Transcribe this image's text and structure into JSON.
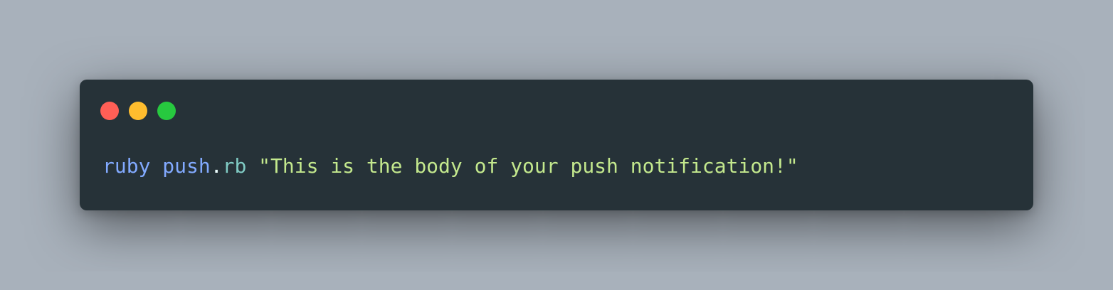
{
  "window": {
    "controls": [
      {
        "name": "close",
        "color": "#ff5f56"
      },
      {
        "name": "minimize",
        "color": "#ffbd2e"
      },
      {
        "name": "maximize",
        "color": "#27c93f"
      }
    ]
  },
  "code": {
    "command": "ruby",
    "file_base": "push",
    "file_dot": ".",
    "file_ext": "rb",
    "argument": "\"This is the body of your push notification!\""
  },
  "colors": {
    "background": "#a8b1bb",
    "terminal_bg": "#263238",
    "command": "#82aaff",
    "file_base": "#82aaff",
    "punctuation": "#eeffff",
    "file_ext": "#80cbc4",
    "string": "#c3e88d"
  }
}
